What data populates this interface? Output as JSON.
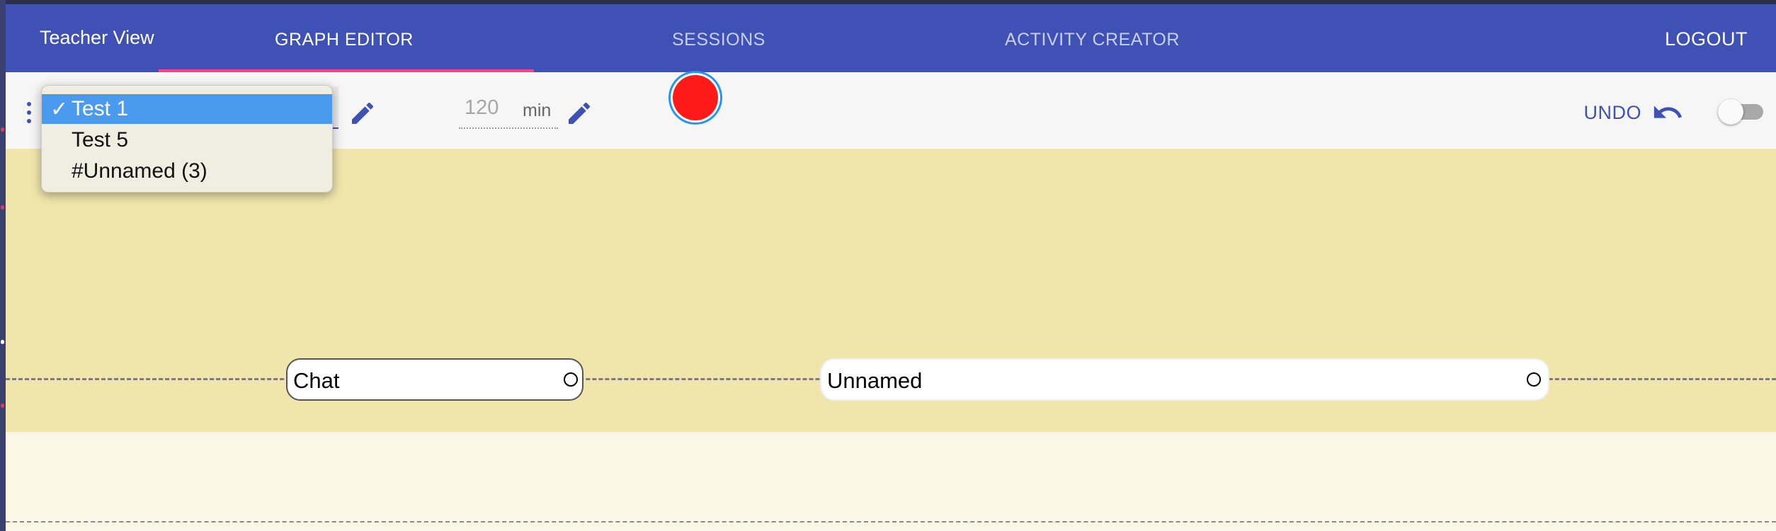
{
  "header": {
    "brand": "Teacher View",
    "tabs": [
      {
        "label": "GRAPH EDITOR",
        "active": true
      },
      {
        "label": "SESSIONS",
        "active": false
      },
      {
        "label": "ACTIVITY CREATOR",
        "active": false
      }
    ],
    "logout_label": "LOGOUT",
    "accent_color": "#3f51b5",
    "indicator_color": "#ff4081"
  },
  "toolbar": {
    "graph_select": {
      "options": [
        {
          "label": "Test 1",
          "selected": true,
          "check": "✓"
        },
        {
          "label": "Test 5",
          "selected": false
        },
        {
          "label": "#Unnamed (3)",
          "selected": false
        }
      ]
    },
    "duration": {
      "value": "120",
      "unit": "min"
    },
    "undo_label": "UNDO",
    "record_color": "#ff1a1a",
    "icons": [
      "drag-handle-icon",
      "pencil-icon",
      "undo-icon"
    ],
    "toggle_on": false
  },
  "graph": {
    "plane_color": "#f0e5ab",
    "activities": [
      {
        "label": "Chat"
      },
      {
        "label": "Unnamed"
      }
    ]
  }
}
